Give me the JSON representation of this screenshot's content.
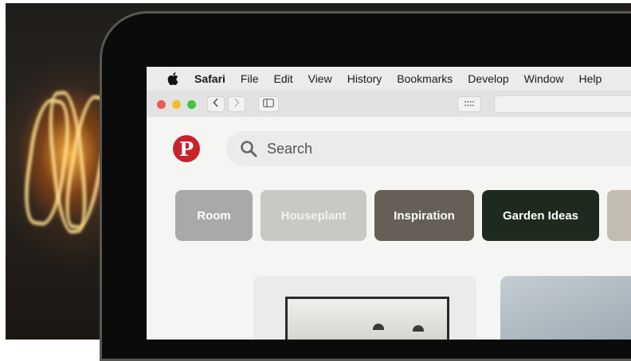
{
  "menubar": {
    "app_name": "Safari",
    "items": [
      "File",
      "Edit",
      "View",
      "History",
      "Bookmarks",
      "Develop",
      "Window",
      "Help"
    ]
  },
  "toolbar": {
    "back_icon": "chevron-left-icon",
    "forward_icon": "chevron-right-icon",
    "sidebar_icon": "sidebar-icon",
    "tabs_grid_icon": "grid-icon"
  },
  "pinterest": {
    "logo_letter": "P",
    "search_placeholder": "Search",
    "chips": [
      {
        "label": "Room",
        "color": "#a9a9a7"
      },
      {
        "label": "Houseplant",
        "color": "#c9c8c5"
      },
      {
        "label": "Inspiration",
        "color": "#655f58"
      },
      {
        "label": "Garden Ideas",
        "color": "#1f2a1f"
      }
    ]
  },
  "colors": {
    "pinterest_red": "#c8232c"
  }
}
